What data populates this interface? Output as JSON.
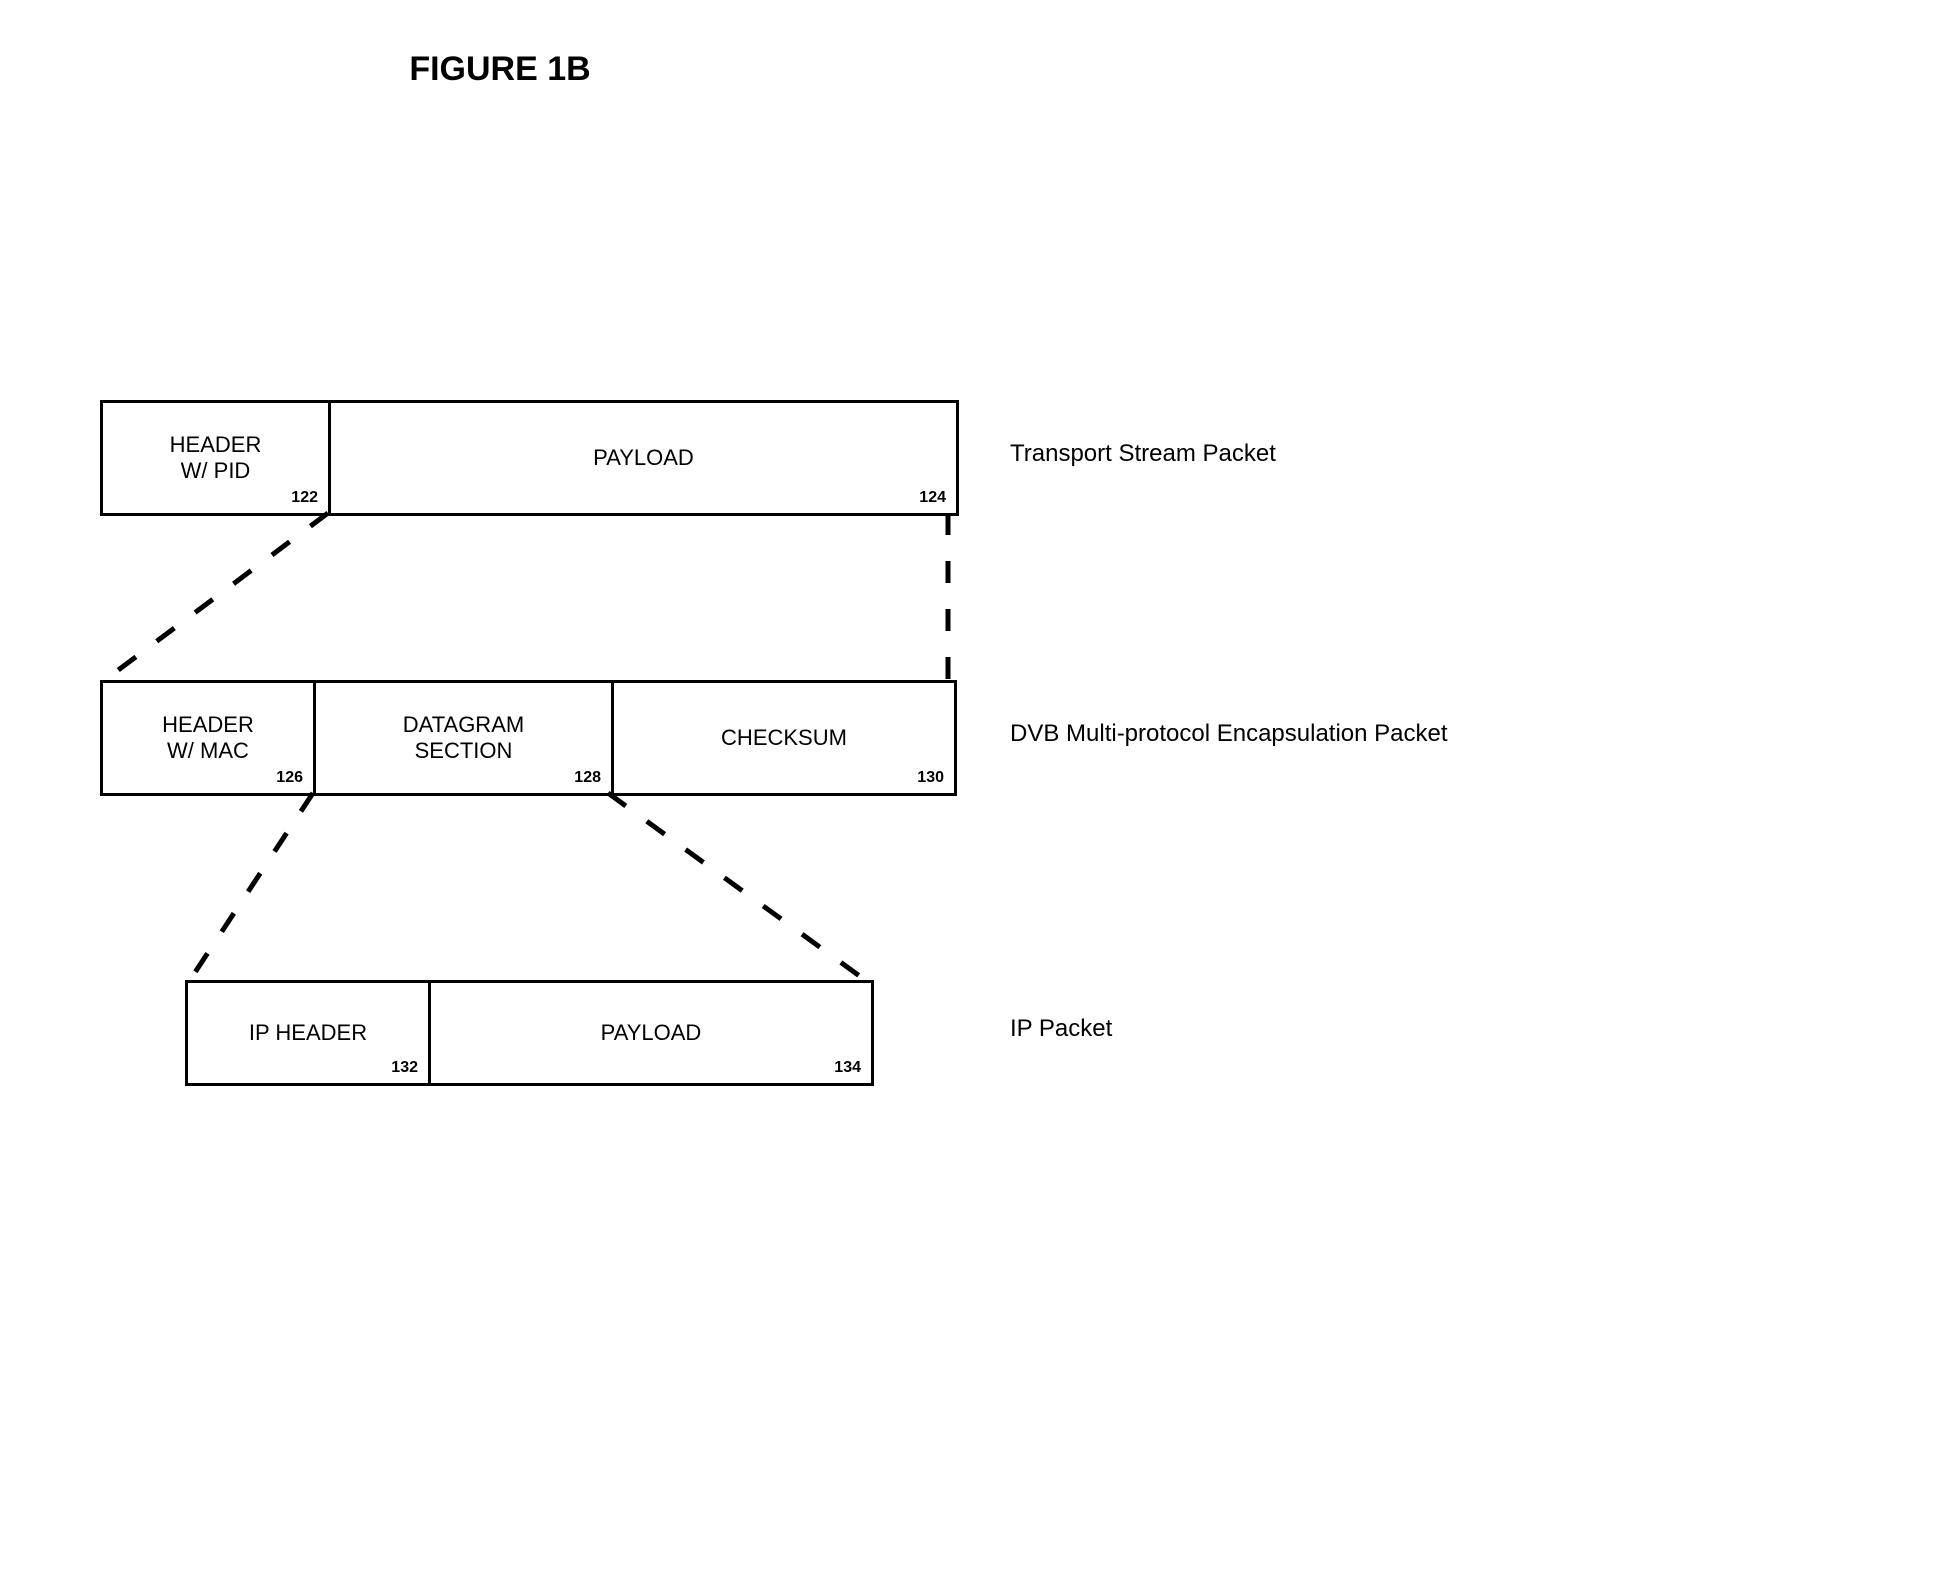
{
  "title": "FIGURE 1B",
  "rows": [
    {
      "label": "Transport Stream Packet",
      "boxes": [
        {
          "text": "HEADER\nW/ PID",
          "ref": "122"
        },
        {
          "text": "PAYLOAD",
          "ref": "124"
        }
      ]
    },
    {
      "label": "DVB Multi-protocol Encapsulation Packet",
      "boxes": [
        {
          "text": "HEADER\nW/ MAC",
          "ref": "126"
        },
        {
          "text": "DATAGRAM\nSECTION",
          "ref": "128"
        },
        {
          "text": "CHECKSUM",
          "ref": "130"
        }
      ]
    },
    {
      "label": "IP Packet",
      "boxes": [
        {
          "text": "IP HEADER",
          "ref": "132"
        },
        {
          "text": "PAYLOAD",
          "ref": "134"
        }
      ]
    }
  ]
}
